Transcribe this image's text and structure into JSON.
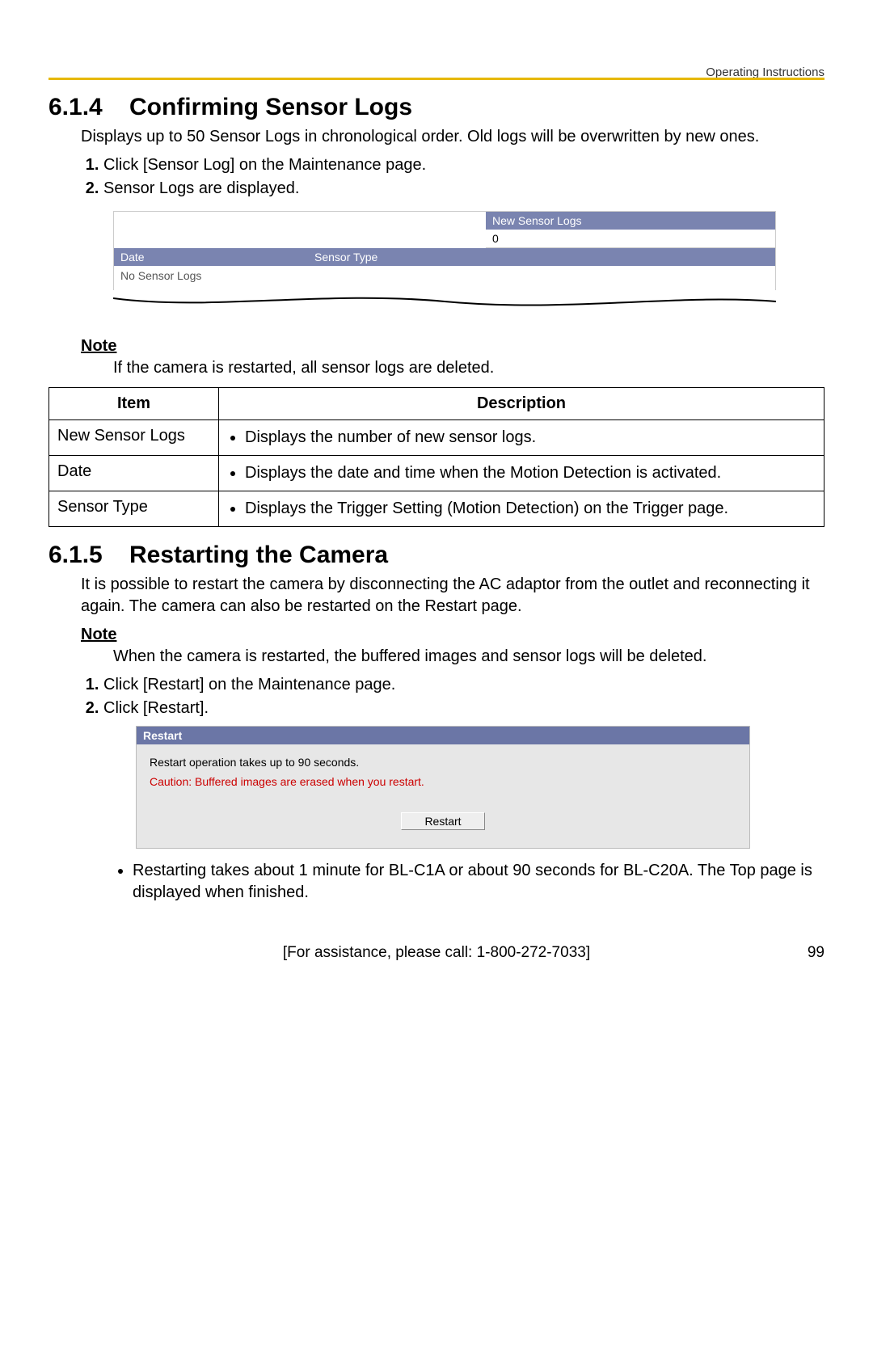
{
  "header": {
    "right": "Operating Instructions"
  },
  "s614": {
    "num": "6.1.4",
    "title": "Confirming Sensor Logs",
    "intro": "Displays up to 50 Sensor Logs in chronological order. Old logs will be overwritten by new ones.",
    "steps": [
      "Click [Sensor Log] on the Maintenance page.",
      "Sensor Logs are displayed."
    ],
    "shot": {
      "new_label": "New Sensor Logs",
      "new_value": "0",
      "col1": "Date",
      "col2": "Sensor Type",
      "empty": "No Sensor Logs"
    },
    "note_label": "Note",
    "note_body": "If the camera is restarted, all sensor logs are deleted."
  },
  "table": {
    "head_item": "Item",
    "head_desc": "Description",
    "rows": [
      {
        "item": "New Sensor Logs",
        "desc": "Displays the number of new sensor logs."
      },
      {
        "item": "Date",
        "desc": "Displays the date and time when the Motion Detection is activated."
      },
      {
        "item": "Sensor Type",
        "desc": "Displays the Trigger Setting (Motion Detection) on the Trigger page."
      }
    ]
  },
  "s615": {
    "num": "6.1.5",
    "title": "Restarting the Camera",
    "intro": "It is possible to restart the camera by disconnecting the AC adaptor from the outlet and reconnecting it again. The camera can also be restarted on the Restart page.",
    "note_label": "Note",
    "note_body": "When the camera is restarted, the buffered images and sensor logs will be deleted.",
    "steps": [
      "Click [Restart] on the Maintenance page.",
      "Click [Restart]."
    ],
    "shot": {
      "title": "Restart",
      "msg1": "Restart operation takes up to 90 seconds.",
      "msg2": "Caution: Buffered images are erased when you restart.",
      "button": "Restart"
    },
    "bullet": "Restarting takes about 1 minute for BL-C1A or about 90 seconds for BL-C20A. The Top page is displayed when finished."
  },
  "footer": {
    "center": "[For assistance, please call: 1-800-272-7033]",
    "page": "99"
  }
}
